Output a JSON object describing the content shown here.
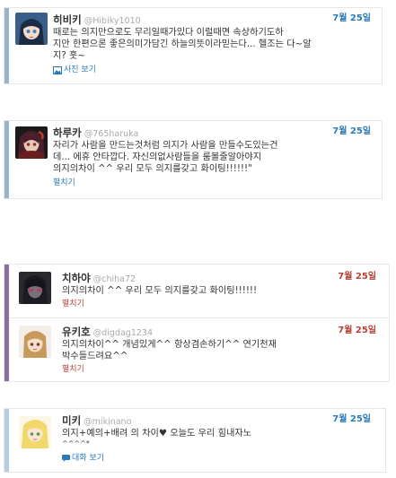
{
  "tweets": [
    {
      "name": "히비키",
      "handle": "@Hibiky1010",
      "date": "7월 25일",
      "lines": [
        "때로는 의지만으로도 무리일때가있다 이럴때면 속상하기도하",
        "지만 한편으론 좋은의미가담긴 하늘의뜻이라믿는다... 헬조는 다~알",
        "지? 훗~"
      ],
      "action": "사진 보기",
      "accent": "#2b7bb9"
    },
    {
      "name": "하루카",
      "handle": "@765haruka",
      "date": "7월 25일",
      "lines": [
        "자리가 사람을 만드는것처럼 의지가 사람을 만들수도있는건",
        "데... 에휴 안타깝다. 자신의없사람들을 룸볼줄알아야지",
        "의지의차이 ^^ 우리 모두 의지를갖고 화이팅!!!!!!\""
      ],
      "action": "펼치기",
      "accent": "#2b7bb9"
    },
    {
      "name": "치하야",
      "handle": "@chiha72",
      "date": "7월 25일",
      "lines": [
        "의지의차이 ^^ 우리 모두 의지를갖고 화이팅!!!!!!"
      ],
      "action": "펼치기",
      "accent": "#b4413a"
    },
    {
      "name": "유키호",
      "handle": "@digdag1234",
      "date": "7월 25일",
      "lines": [
        "의지의차이^^ 개념있게^^ 항상겸손하기^^ 연기천재",
        "박수들드려요^^"
      ],
      "action": "펼치기",
      "accent": "#b4413a"
    },
    {
      "name": "미키",
      "handle": "@mikinano",
      "date": "7월 25일",
      "lines": [
        "의지+예의+배려 의 차이♥ 오늘도 우리 힘내자노"
      ],
      "small": "^^^^*",
      "action": "대화 보기",
      "accent": "#2b7bb9"
    }
  ],
  "colors": {
    "bar_blue": "#9ab3cc",
    "bar_purple": "#8a6f9e",
    "bar_light": "#b8cce0",
    "link": "#2b7bb9",
    "link_red": "#b4413a"
  }
}
